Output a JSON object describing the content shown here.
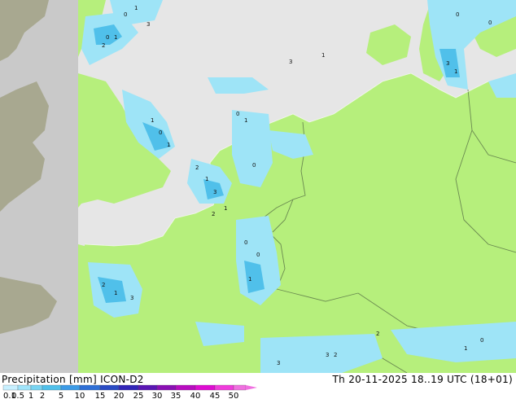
{
  "header": {
    "title_left": "Precipitation [mm]  ICON-D2",
    "title_right": "Th 20-11-2025  18..19 UTC (18+01)"
  },
  "legend": {
    "ticks": [
      "0.1",
      "0.5",
      "1",
      "2",
      "5",
      "10",
      "15",
      "20",
      "25",
      "30",
      "35",
      "40",
      "45",
      "50"
    ],
    "colors": [
      "#c8f0ff",
      "#a0e4fa",
      "#78d4f2",
      "#50c0ea",
      "#3c9be6",
      "#2f6fd6",
      "#2a4bc4",
      "#3226b8",
      "#5a17b4",
      "#8a10b4",
      "#b80cc0",
      "#de0cd2",
      "#f03cdc",
      "#f070e0"
    ]
  },
  "map": {
    "colors": {
      "land_model": "#b6ef7c",
      "sea": "#e6e6e6",
      "land_outside": "#c9c9c9",
      "uk_land": "#a8a890",
      "precip_light": "#9ee4f7",
      "precip_mid": "#50c0ea",
      "borders": "#6a8a50"
    },
    "value_labels": [
      "0",
      "1",
      "2",
      "3"
    ]
  }
}
